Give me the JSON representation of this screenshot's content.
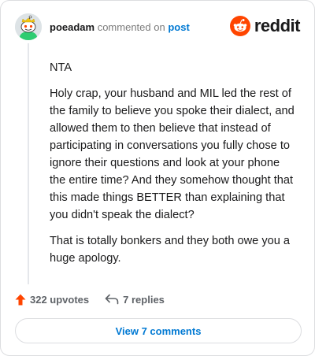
{
  "header": {
    "username": "poeadam",
    "action": "commented on",
    "target": "post"
  },
  "brand": {
    "name": "reddit",
    "accent": "#ff4500"
  },
  "comment": {
    "paragraphs": [
      "NTA",
      "Holy crap, your husband and MIL led the rest of the family to believe you spoke their dialect, and allowed them to then believe that instead of participating in conversations you fully chose to ignore their questions and look at your phone the entire time? And they somehow thought that this made things BETTER than explaining that you didn't speak the dialect?",
      "That is totally bonkers and they both owe you a huge apology."
    ]
  },
  "footer": {
    "upvotes": "322 upvotes",
    "replies": "7 replies",
    "upvote_icon": "upvote-arrow-icon",
    "reply_icon": "reply-arrow-icon"
  },
  "view_button": {
    "label": "View 7 comments"
  },
  "colors": {
    "link": "#0079d3",
    "upvote": "#ff4500",
    "muted": "#7c7c7c"
  }
}
